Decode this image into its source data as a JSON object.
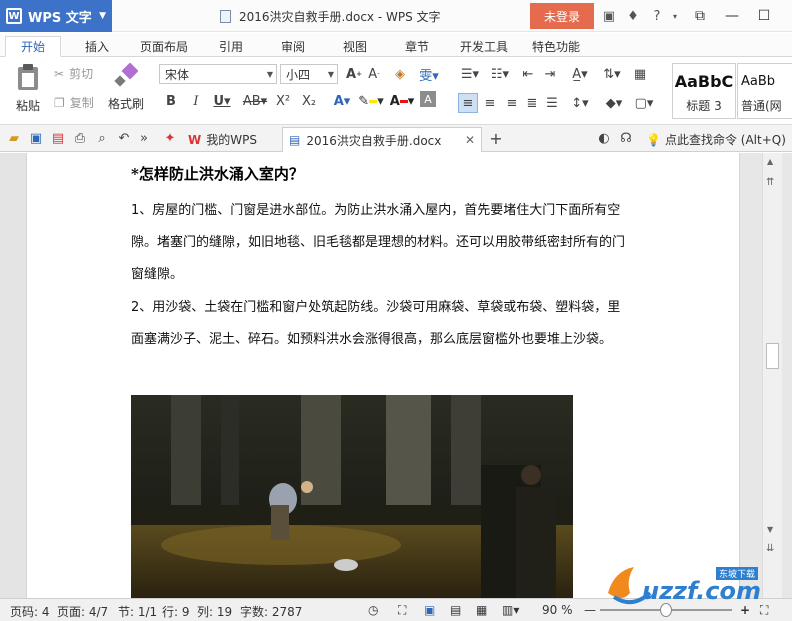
{
  "app": {
    "name": "WPS 文字",
    "logo_letter": "W",
    "window_title": "2016洪灾自救手册.docx - WPS 文字",
    "login_label": "未登录"
  },
  "ribbon_tabs": [
    {
      "label": "开始",
      "active": true
    },
    {
      "label": "插入"
    },
    {
      "label": "页面布局"
    },
    {
      "label": "引用"
    },
    {
      "label": "审阅"
    },
    {
      "label": "视图"
    },
    {
      "label": "章节"
    },
    {
      "label": "开发工具"
    },
    {
      "label": "特色功能"
    }
  ],
  "ribbon": {
    "paste_label": "粘贴",
    "cut_label": "剪切",
    "copy_label": "复制",
    "format_painter_label": "格式刷",
    "font_name": "宋体",
    "font_size": "小四",
    "style_preview_1": "AaBbC",
    "style_name_1": "标题 3",
    "style_preview_2": "AaBb",
    "style_name_2": "普通(网"
  },
  "quickbar": {
    "tab_mywps": "我的WPS",
    "tab_doc": "2016洪灾自救手册.docx",
    "new_tab": "+",
    "search_label": "点此查找命令 (Alt+Q)"
  },
  "document": {
    "heading": "*怎样防止洪水涌入室内？",
    "paragraphs": [
      "1、房屋的门槛、门窗是进水部位。为防止洪水涌入屋内，首先要堵住大门下面所有空隙。堵塞门的缝隙，如旧地毯、旧毛毯都是理想的材料。还可以用胶带纸密封所有的门窗缝隙。",
      "2、用沙袋、土袋在门槛和窗户处筑起防线。沙袋可用麻袋、草袋或布袋、塑料袋，里面塞满沙子、泥土、碎石。如预料洪水会涨得很高，那么底层窗槛外也要堆上沙袋。"
    ]
  },
  "status": {
    "page_no": "页码: 4",
    "page_count": "页面: 4/7",
    "section": "节: 1/1",
    "row": "行: 9",
    "col": "列: 19",
    "word_count": "字数: 2787",
    "zoom": "90 %",
    "zoom_level": 0.5
  },
  "watermark": {
    "brand": "uzzf.com",
    "tagline": "东坡下载"
  },
  "colors": {
    "accent": "#3d72c9",
    "login": "#e46b4d",
    "tab_active": "#2f66b8"
  }
}
